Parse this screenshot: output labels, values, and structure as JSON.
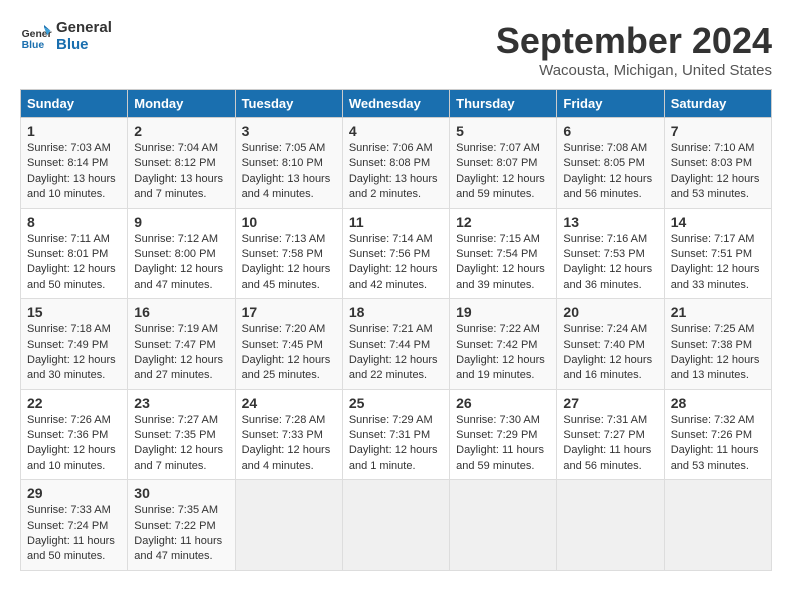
{
  "header": {
    "logo_line1": "General",
    "logo_line2": "Blue",
    "month_year": "September 2024",
    "location": "Wacousta, Michigan, United States"
  },
  "days_of_week": [
    "Sunday",
    "Monday",
    "Tuesday",
    "Wednesday",
    "Thursday",
    "Friday",
    "Saturday"
  ],
  "weeks": [
    [
      {
        "day": "1",
        "sunrise": "7:03 AM",
        "sunset": "8:14 PM",
        "daylight": "13 hours and 10 minutes."
      },
      {
        "day": "2",
        "sunrise": "7:04 AM",
        "sunset": "8:12 PM",
        "daylight": "13 hours and 7 minutes."
      },
      {
        "day": "3",
        "sunrise": "7:05 AM",
        "sunset": "8:10 PM",
        "daylight": "13 hours and 4 minutes."
      },
      {
        "day": "4",
        "sunrise": "7:06 AM",
        "sunset": "8:08 PM",
        "daylight": "13 hours and 2 minutes."
      },
      {
        "day": "5",
        "sunrise": "7:07 AM",
        "sunset": "8:07 PM",
        "daylight": "12 hours and 59 minutes."
      },
      {
        "day": "6",
        "sunrise": "7:08 AM",
        "sunset": "8:05 PM",
        "daylight": "12 hours and 56 minutes."
      },
      {
        "day": "7",
        "sunrise": "7:10 AM",
        "sunset": "8:03 PM",
        "daylight": "12 hours and 53 minutes."
      }
    ],
    [
      {
        "day": "8",
        "sunrise": "7:11 AM",
        "sunset": "8:01 PM",
        "daylight": "12 hours and 50 minutes."
      },
      {
        "day": "9",
        "sunrise": "7:12 AM",
        "sunset": "8:00 PM",
        "daylight": "12 hours and 47 minutes."
      },
      {
        "day": "10",
        "sunrise": "7:13 AM",
        "sunset": "7:58 PM",
        "daylight": "12 hours and 45 minutes."
      },
      {
        "day": "11",
        "sunrise": "7:14 AM",
        "sunset": "7:56 PM",
        "daylight": "12 hours and 42 minutes."
      },
      {
        "day": "12",
        "sunrise": "7:15 AM",
        "sunset": "7:54 PM",
        "daylight": "12 hours and 39 minutes."
      },
      {
        "day": "13",
        "sunrise": "7:16 AM",
        "sunset": "7:53 PM",
        "daylight": "12 hours and 36 minutes."
      },
      {
        "day": "14",
        "sunrise": "7:17 AM",
        "sunset": "7:51 PM",
        "daylight": "12 hours and 33 minutes."
      }
    ],
    [
      {
        "day": "15",
        "sunrise": "7:18 AM",
        "sunset": "7:49 PM",
        "daylight": "12 hours and 30 minutes."
      },
      {
        "day": "16",
        "sunrise": "7:19 AM",
        "sunset": "7:47 PM",
        "daylight": "12 hours and 27 minutes."
      },
      {
        "day": "17",
        "sunrise": "7:20 AM",
        "sunset": "7:45 PM",
        "daylight": "12 hours and 25 minutes."
      },
      {
        "day": "18",
        "sunrise": "7:21 AM",
        "sunset": "7:44 PM",
        "daylight": "12 hours and 22 minutes."
      },
      {
        "day": "19",
        "sunrise": "7:22 AM",
        "sunset": "7:42 PM",
        "daylight": "12 hours and 19 minutes."
      },
      {
        "day": "20",
        "sunrise": "7:24 AM",
        "sunset": "7:40 PM",
        "daylight": "12 hours and 16 minutes."
      },
      {
        "day": "21",
        "sunrise": "7:25 AM",
        "sunset": "7:38 PM",
        "daylight": "12 hours and 13 minutes."
      }
    ],
    [
      {
        "day": "22",
        "sunrise": "7:26 AM",
        "sunset": "7:36 PM",
        "daylight": "12 hours and 10 minutes."
      },
      {
        "day": "23",
        "sunrise": "7:27 AM",
        "sunset": "7:35 PM",
        "daylight": "12 hours and 7 minutes."
      },
      {
        "day": "24",
        "sunrise": "7:28 AM",
        "sunset": "7:33 PM",
        "daylight": "12 hours and 4 minutes."
      },
      {
        "day": "25",
        "sunrise": "7:29 AM",
        "sunset": "7:31 PM",
        "daylight": "12 hours and 1 minute."
      },
      {
        "day": "26",
        "sunrise": "7:30 AM",
        "sunset": "7:29 PM",
        "daylight": "11 hours and 59 minutes."
      },
      {
        "day": "27",
        "sunrise": "7:31 AM",
        "sunset": "7:27 PM",
        "daylight": "11 hours and 56 minutes."
      },
      {
        "day": "28",
        "sunrise": "7:32 AM",
        "sunset": "7:26 PM",
        "daylight": "11 hours and 53 minutes."
      }
    ],
    [
      {
        "day": "29",
        "sunrise": "7:33 AM",
        "sunset": "7:24 PM",
        "daylight": "11 hours and 50 minutes."
      },
      {
        "day": "30",
        "sunrise": "7:35 AM",
        "sunset": "7:22 PM",
        "daylight": "11 hours and 47 minutes."
      },
      null,
      null,
      null,
      null,
      null
    ]
  ]
}
